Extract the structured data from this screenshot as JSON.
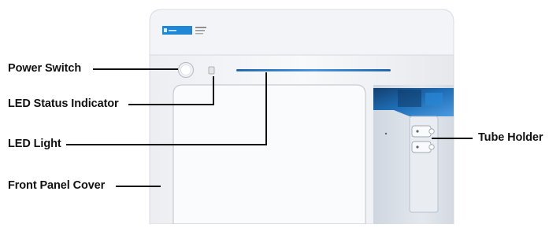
{
  "labels": {
    "power_switch": "Power Switch",
    "led_status_indicator": "LED Status Indicator",
    "led_light": "LED Light",
    "front_panel_cover": "Front Panel Cover",
    "tube_holder": "Tube Holder"
  },
  "colors": {
    "instrument_body": "#f6f7f9",
    "led_light_strip": "#2c7fd4",
    "logo_blue": "#1e88d6",
    "callout_line": "#111111",
    "internal_blue": "#1a6fb8"
  }
}
